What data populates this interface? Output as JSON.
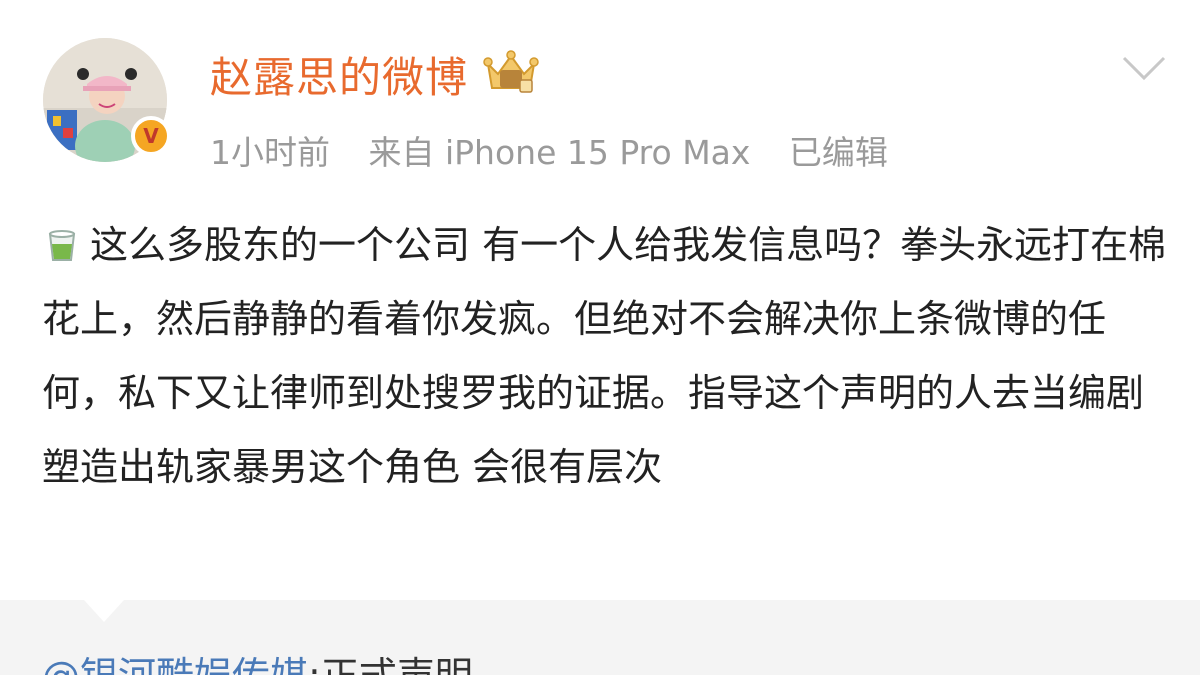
{
  "author": {
    "name": "赵露思的微博",
    "avatar_icon": "avatar-photo",
    "verified_icon": "verified-v-icon",
    "verified_letter": "V",
    "vip_icon": "vip-crown-icon",
    "name_color": "#e86a2e"
  },
  "meta": {
    "time": "1小时前",
    "source": "来自 iPhone 15 Pro Max",
    "edited": "已编辑"
  },
  "menu": {
    "icon": "chevron-down-icon"
  },
  "post": {
    "leading_icon": "tea-cup-icon",
    "text": "这么多股东的一个公司 有一个人给我发信息吗？拳头永远打在棉花上，然后静静的看着你发疯。但绝对不会解决你上条微博的任何，私下又让律师到处搜罗我的证据。指导这个声明的人去当编剧 塑造出轨家暴男这个角色 会很有层次"
  },
  "repost": {
    "mention": "@银河酷娱传媒",
    "suffix": ":正式声明",
    "mention_color": "#4a7ab8"
  }
}
